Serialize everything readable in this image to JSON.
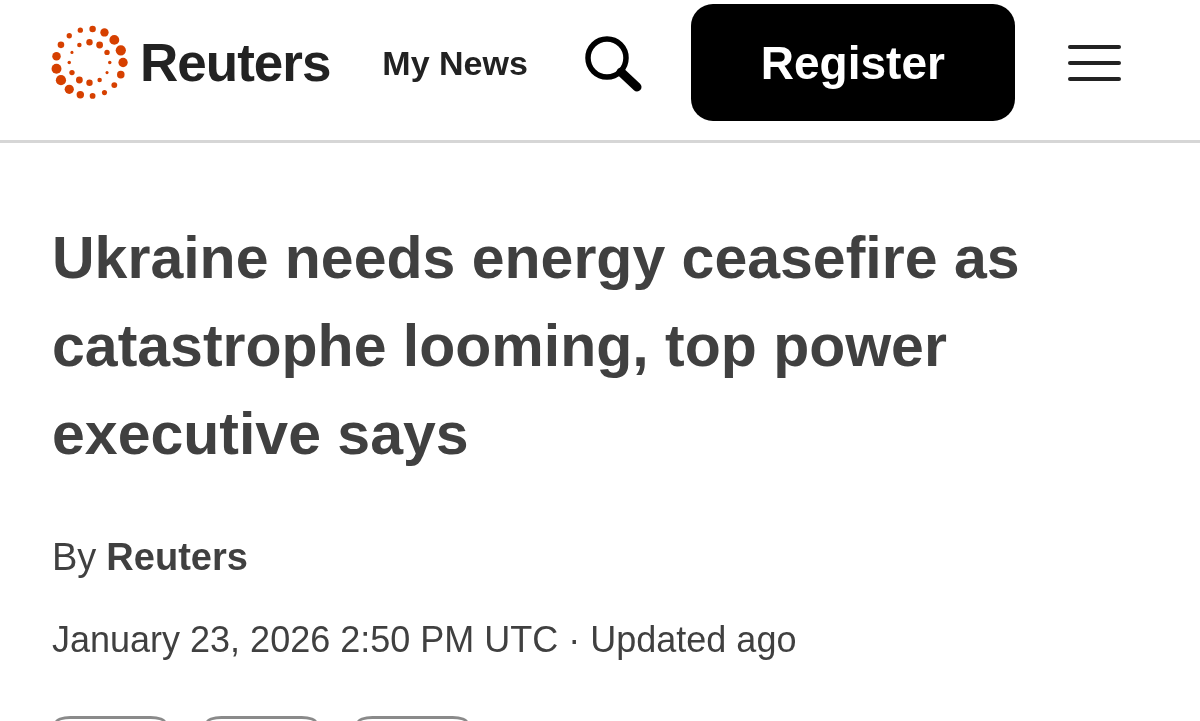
{
  "header": {
    "logo": {
      "wordmark": "Reuters"
    },
    "nav_link": "My News",
    "register_button": "Register"
  },
  "article": {
    "headline": "Ukraine needs energy ceasefire as catastrophe looming, top power executive says",
    "byline": {
      "prefix": "By",
      "author": "Reuters"
    },
    "timestamp": "January 23, 2026 2:50 PM UTC · Updated ago"
  },
  "action_buttons": [
    {
      "kind": "outline"
    },
    {
      "kind": "outline"
    },
    {
      "kind": "outline"
    }
  ]
}
